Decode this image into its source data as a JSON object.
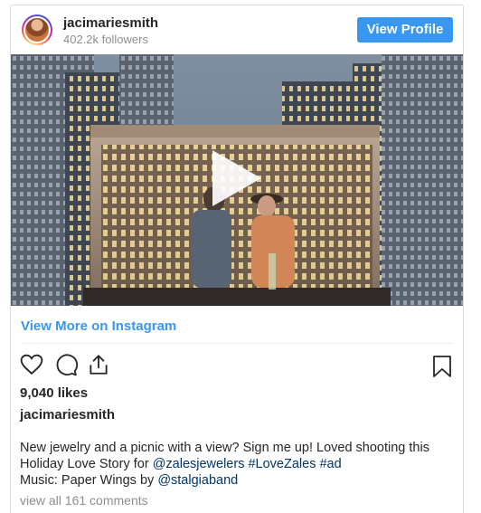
{
  "header": {
    "username": "jacimariesmith",
    "followers": "402.2k followers",
    "view_profile_label": "View Profile"
  },
  "media": {
    "play_icon": "play-icon"
  },
  "view_more_label": "View More on Instagram",
  "actions": {
    "icons": [
      "heart-icon",
      "comment-icon",
      "share-icon",
      "bookmark-icon"
    ]
  },
  "likes": "9,040 likes",
  "author": "jacimariesmith",
  "caption": {
    "line1": "New jewelry and a picnic with a view? Sign me up! Loved shooting this",
    "line2_prefix": "Holiday Love Story for ",
    "mention1": "@zalesjewelers",
    "hashtag1": "#LoveZales",
    "hashtag2": "#ad",
    "line3_prefix": "Music: Paper Wings by ",
    "mention2": "@stalgiaband"
  },
  "view_comments": "view all 161 comments",
  "colors": {
    "accent": "#3897f0",
    "link": "#003569",
    "muted": "#8e8e8e"
  }
}
